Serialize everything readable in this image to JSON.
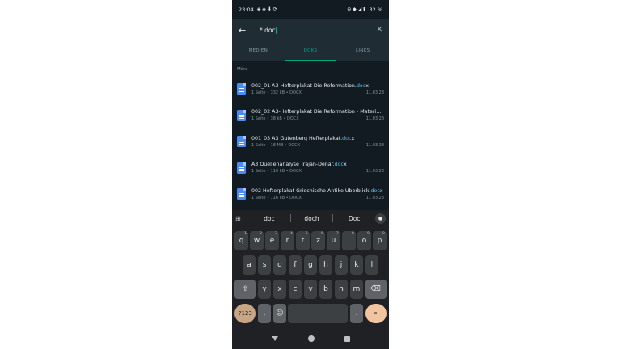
{
  "status": {
    "time": "23:04",
    "battery": "32 %"
  },
  "search": {
    "query": "*.doc"
  },
  "tabs": [
    {
      "label": "MEDIEN"
    },
    {
      "label": "DOKS"
    },
    {
      "label": "LINKS"
    }
  ],
  "section_header": "März",
  "documents": [
    {
      "pre": "002_01 A3-Hefterplakat Die Reformation.",
      "match": "doc",
      "post": "x",
      "info": "1 Seite • 332 kB • DOCX",
      "date": "11.03.23"
    },
    {
      "pre": "002_02 A3-Hefterplakat Die Reformation - Material-...",
      "match": "",
      "post": "",
      "info": "1 Seite • 38 kB • DOCX",
      "date": "11.03.23"
    },
    {
      "pre": "001_03 A3 Gutenberg Hefterplakat.",
      "match": "doc",
      "post": "x",
      "info": "1 Seite • 18 MB • DOCX",
      "date": "11.03.23"
    },
    {
      "pre": "A3 Quellenanalyse Trajan-Denar.",
      "match": "doc",
      "post": "x",
      "info": "1 Seite • 110 kB • DOCX",
      "date": "11.03.23"
    },
    {
      "pre": "002 Hefterplakat Griechische Antike Überblick.",
      "match": "doc",
      "post": "x",
      "info": "1 Seite • 116 kB • DOCX",
      "date": "11.03.23"
    }
  ],
  "keyboard": {
    "suggestions": [
      "doc",
      "doch",
      "Doc"
    ],
    "row1": [
      [
        "q",
        "1"
      ],
      [
        "w",
        "2"
      ],
      [
        "e",
        "3"
      ],
      [
        "r",
        "4"
      ],
      [
        "t",
        "5"
      ],
      [
        "z",
        "6"
      ],
      [
        "u",
        "7"
      ],
      [
        "i",
        "8"
      ],
      [
        "o",
        "9"
      ],
      [
        "p",
        "0"
      ]
    ],
    "row2": [
      "a",
      "s",
      "d",
      "f",
      "g",
      "h",
      "j",
      "k",
      "l"
    ],
    "row3": [
      "y",
      "x",
      "c",
      "v",
      "b",
      "n",
      "m"
    ],
    "symbols_label": "?123",
    "comma": ",",
    "period": "."
  }
}
